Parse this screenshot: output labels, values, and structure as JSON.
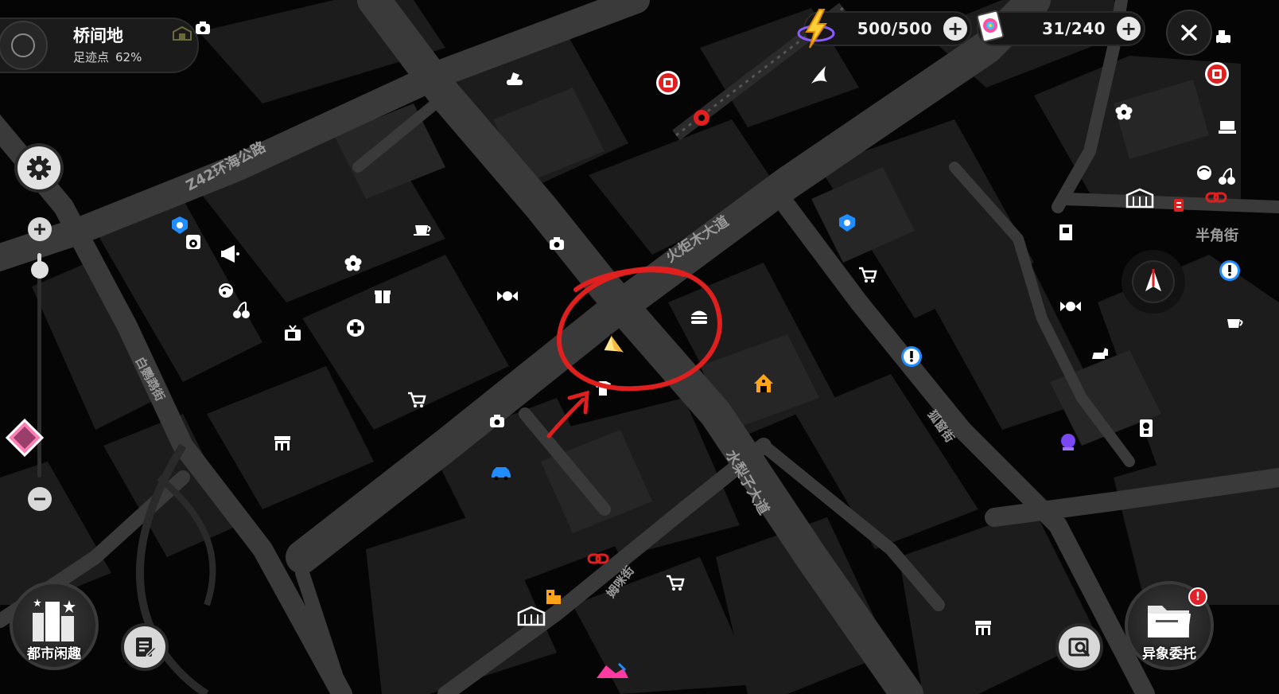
{
  "location": {
    "title": "桥间地",
    "progress_label": "足迹点",
    "progress_value": "62%"
  },
  "resources": [
    {
      "name": "battery-charge",
      "value": "500/500",
      "icon": "lightning-icon"
    },
    {
      "name": "film-count",
      "value": "31/240",
      "icon": "film-card-icon"
    }
  ],
  "streets": {
    "z42": "Z42环海公路",
    "torch": "火炬木大道",
    "baiying": "白鹦鹉街",
    "shuili": "水梨子大道",
    "mimi": "姆咪街",
    "hugou": "狐窗街",
    "banjiao": "半角街"
  },
  "buttons": {
    "city_fun": "都市闲趣",
    "anomaly_commission": "异象委托",
    "notification_badge": "!"
  },
  "colors": {
    "map_background": "#050505",
    "block": "#1c1c1c",
    "road": "#3a3a3a",
    "accent_red": "#e01f1f",
    "accent_orange": "#ffa31a",
    "accent_blue": "#1f8cff",
    "accent_purple": "#7a47f5"
  },
  "zoom_level": 0.08
}
